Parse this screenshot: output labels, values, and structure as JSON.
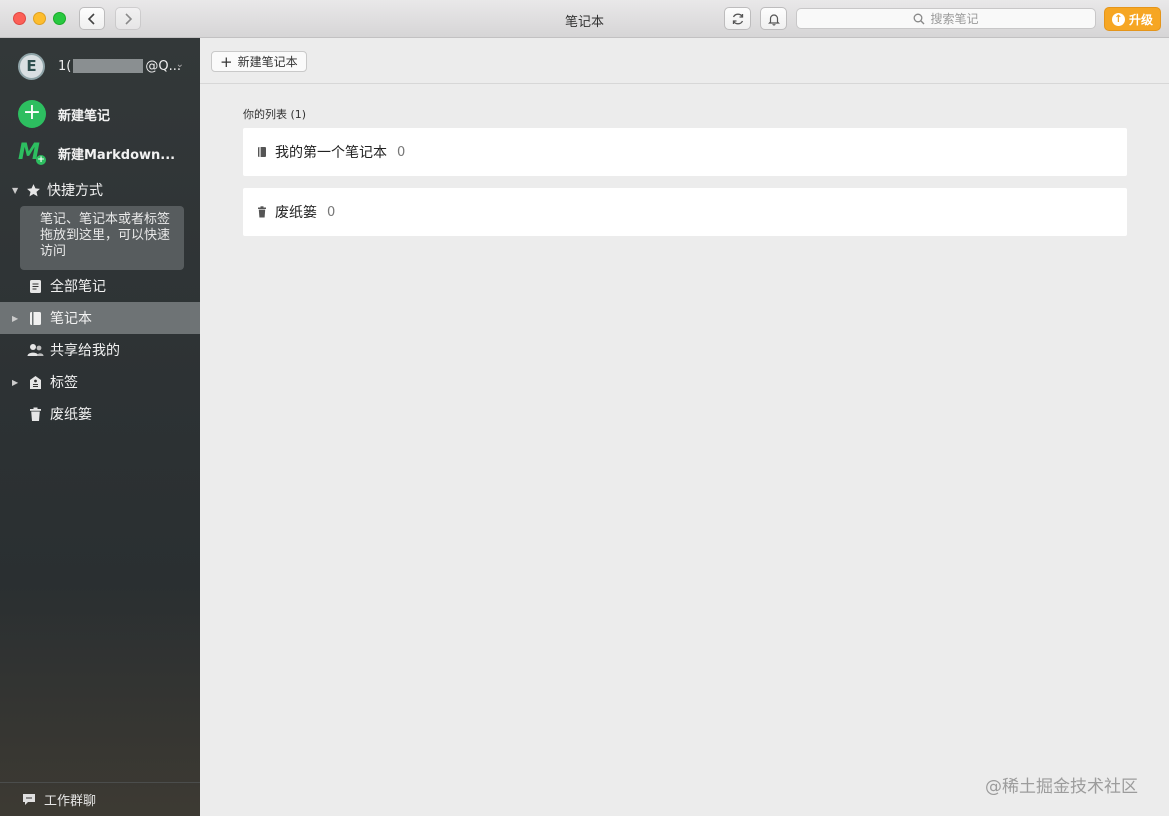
{
  "window": {
    "title": "笔记本",
    "search_placeholder": "搜索笔记",
    "upgrade_label": "升级"
  },
  "sidebar": {
    "account": {
      "avatar_letter": "E",
      "name_prefix": "1(",
      "name_suffix": "@Q..."
    },
    "new_note": "新建笔记",
    "new_markdown": "新建Markdown...",
    "shortcuts": {
      "label": "快捷方式",
      "hint": "笔记、笔记本或者标签拖放到这里，可以快速访问"
    },
    "items": [
      {
        "label": "全部笔记",
        "icon": "notes-icon"
      },
      {
        "label": "笔记本",
        "icon": "notebook-icon"
      },
      {
        "label": "共享给我的",
        "icon": "people-icon"
      },
      {
        "label": "标签",
        "icon": "tag-icon"
      },
      {
        "label": "废纸篓",
        "icon": "trash-icon"
      }
    ],
    "footer": "工作群聊"
  },
  "main": {
    "new_notebook_button": "新建笔记本",
    "list_heading": "你的列表 (1)",
    "rows": [
      {
        "name": "我的第一个笔记本",
        "count": "0"
      },
      {
        "name": "废纸篓",
        "count": "0"
      }
    ]
  },
  "credit": "@稀土掘金技术社区",
  "colors": {
    "accent_green": "#2dbe60",
    "upgrade_orange": "#f6a623",
    "sidebar_bg": "#2d3234"
  }
}
